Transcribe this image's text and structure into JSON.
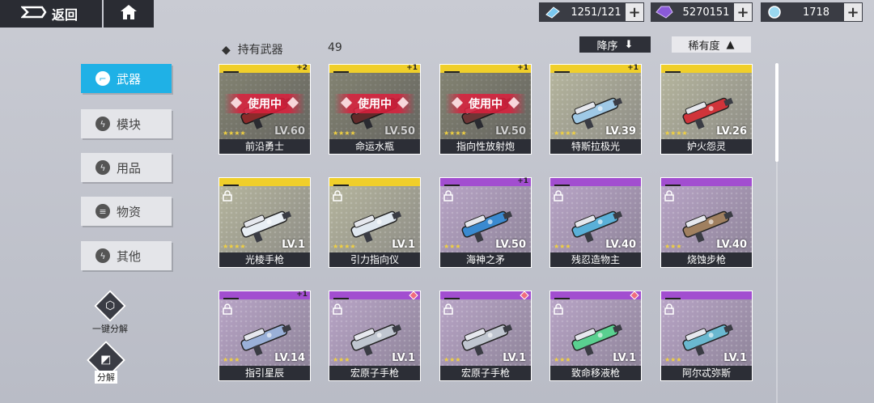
{
  "topbar": {
    "back_label": "返回",
    "resources": [
      {
        "name": "ticket",
        "value": "1251/121"
      },
      {
        "name": "crystal",
        "value": "5270151"
      },
      {
        "name": "orb",
        "value": "1718"
      }
    ],
    "plus": "+"
  },
  "sidebar": {
    "items": [
      {
        "label": "武器",
        "active": true
      },
      {
        "label": "模块",
        "active": false
      },
      {
        "label": "用品",
        "active": false
      },
      {
        "label": "物资",
        "active": false
      },
      {
        "label": "其他",
        "active": false
      }
    ],
    "one_click_decompose": "一键分解",
    "decompose": "分解"
  },
  "header": {
    "title": "持有武器",
    "count": "49",
    "sort_label": "降序",
    "rarity_label": "稀有度"
  },
  "cards": [
    {
      "name": "前沿勇士",
      "level": "LV.60",
      "rarity": "yellow",
      "stars": "★★★★",
      "in_use": "使用中",
      "badge": "+2",
      "color": "#c23a3a"
    },
    {
      "name": "命运水瓶",
      "level": "LV.50",
      "rarity": "yellow",
      "stars": "★★★★",
      "in_use": "使用中",
      "badge": "+1",
      "color": "#8a3a3a"
    },
    {
      "name": "指向性放射炮",
      "level": "LV.50",
      "rarity": "yellow",
      "stars": "★★★★",
      "in_use": "使用中",
      "badge": "+1",
      "color": "#9a4a4a"
    },
    {
      "name": "特斯拉极光",
      "level": "LV.39",
      "rarity": "yellow",
      "stars": "★★★★",
      "in_use": "",
      "badge": "+1",
      "color": "#9fc9e6"
    },
    {
      "name": "妒火怨灵",
      "level": "LV.26",
      "rarity": "yellow",
      "stars": "★★★★",
      "in_use": "",
      "badge": "",
      "color": "#d0343a"
    },
    {
      "name": "光棱手枪",
      "level": "LV.1",
      "rarity": "yellow",
      "stars": "★★★★",
      "in_use": "",
      "badge": "",
      "color": "#e8eef4"
    },
    {
      "name": "引力指向仪",
      "level": "LV.1",
      "rarity": "yellow",
      "stars": "★★★★",
      "in_use": "",
      "badge": "",
      "color": "#e0e8f0"
    },
    {
      "name": "海神之矛",
      "level": "LV.50",
      "rarity": "purple",
      "stars": "★★★",
      "in_use": "",
      "badge": "+1",
      "color": "#3a8ad0"
    },
    {
      "name": "残忍造物主",
      "level": "LV.40",
      "rarity": "purple",
      "stars": "★★★",
      "in_use": "",
      "badge": "",
      "color": "#5ab0d8"
    },
    {
      "name": "烧蚀步枪",
      "level": "LV.40",
      "rarity": "purple",
      "stars": "★★★",
      "in_use": "",
      "badge": "",
      "color": "#a08060"
    },
    {
      "name": "指引星辰",
      "level": "LV.14",
      "rarity": "purple",
      "stars": "★★★",
      "in_use": "",
      "badge": "+1",
      "color": "#9ab0d8"
    },
    {
      "name": "宏原子手枪",
      "level": "LV.1",
      "rarity": "purple",
      "stars": "★★★",
      "in_use": "",
      "badge": "gem",
      "color": "#c0c6d0"
    },
    {
      "name": "宏原子手枪",
      "level": "LV.1",
      "rarity": "purple",
      "stars": "★★★",
      "in_use": "",
      "badge": "gem",
      "color": "#c0c6d0"
    },
    {
      "name": "致命移液枪",
      "level": "LV.1",
      "rarity": "purple",
      "stars": "★★★",
      "in_use": "",
      "badge": "gem",
      "color": "#5ad090"
    },
    {
      "name": "阿尔忒弥斯",
      "level": "LV.1",
      "rarity": "purple",
      "stars": "★★★",
      "in_use": "",
      "badge": "",
      "color": "#6ab8d0"
    }
  ]
}
